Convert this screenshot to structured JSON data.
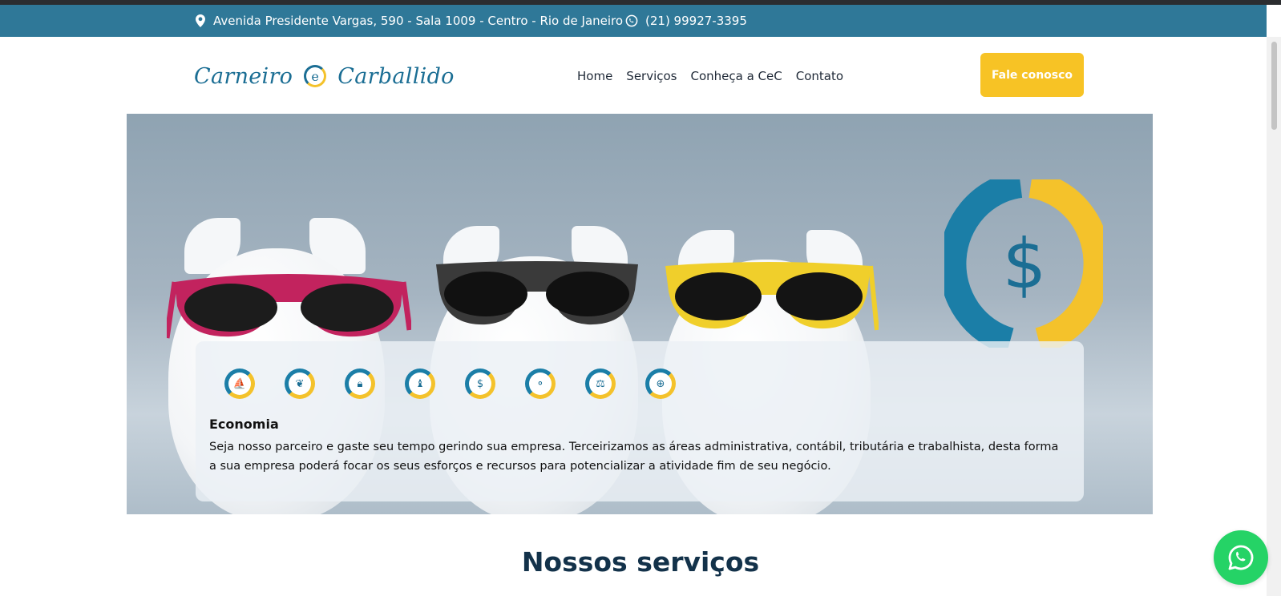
{
  "topbar": {
    "address": "Avenida Presidente Vargas, 590 - Sala 1009 - Centro - Rio de Janeiro",
    "phone": "(21) 99927-3395"
  },
  "brand": {
    "logo_part1": "Carneiro",
    "logo_e": "e",
    "logo_part2": "Carballido",
    "primary_color": "#2f7898",
    "accent_color": "#f7c325"
  },
  "nav": {
    "items": [
      "Home",
      "Serviços",
      "Conheça a CeC",
      "Contato"
    ],
    "cta": "Fale conosco"
  },
  "hero": {
    "service_icons": [
      "boat-icon",
      "leaf-icon",
      "lock-icon",
      "info-icon",
      "dollar-icon",
      "network-icon",
      "scales-icon",
      "globe-icon"
    ],
    "title": "Economia",
    "text": "Seja nosso parceiro e gaste seu tempo gerindo sua empresa. Terceirizamos as áreas administrativa, contábil, tributária e trabalhista, desta forma a sua empresa poderá focar os seus esforços e recursos para potencializar a atividade fim de seu negócio."
  },
  "section": {
    "title": "Nossos serviços"
  },
  "whatsapp": {
    "color": "#25d366"
  }
}
